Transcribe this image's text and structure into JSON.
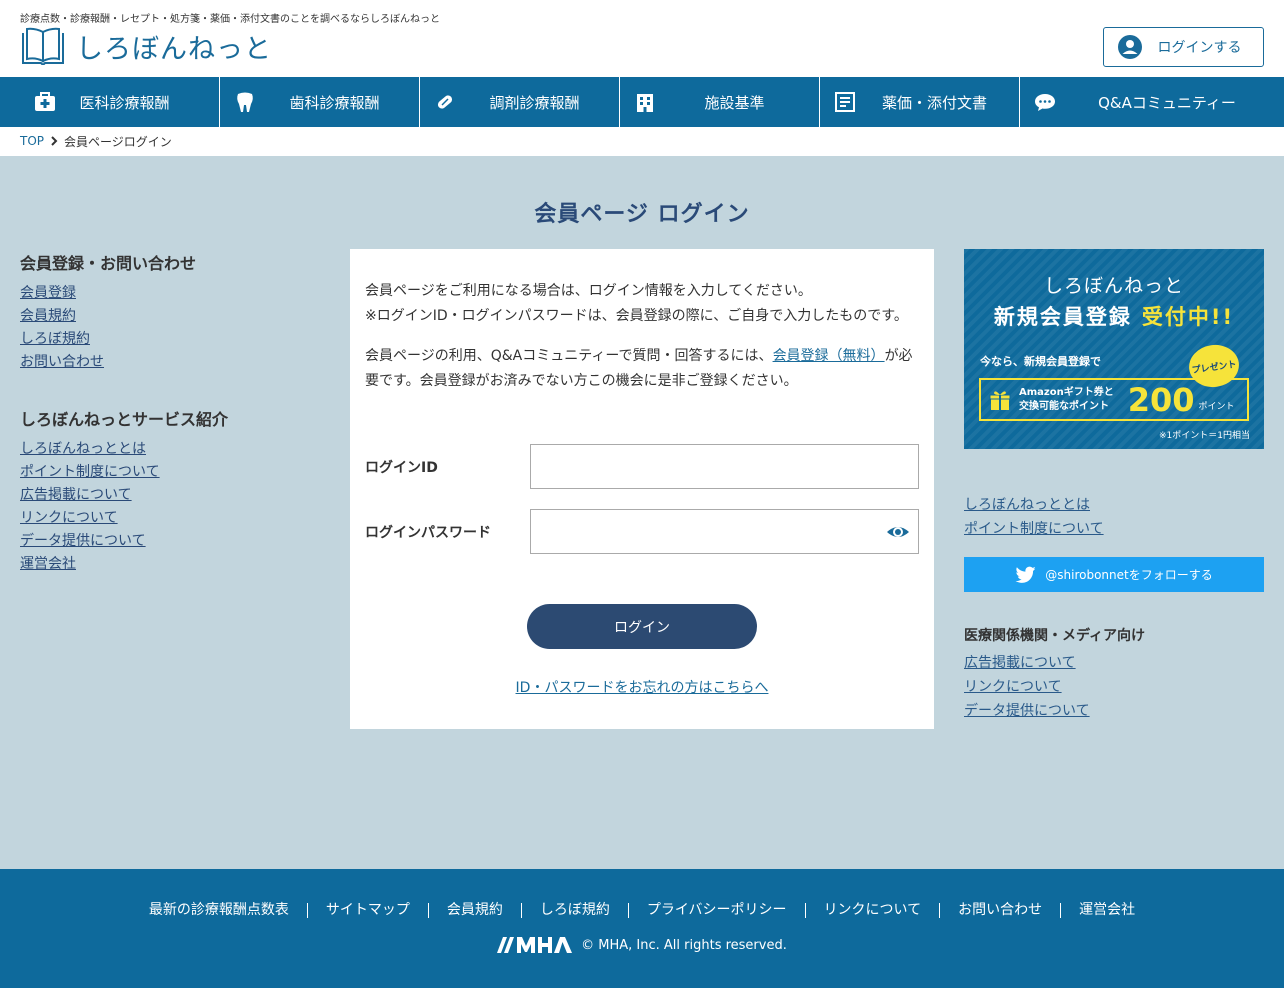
{
  "header": {
    "tagline": "診療点数・診療報酬・レセプト・処方箋・薬価・添付文書のことを調べるならしろぼんねっと",
    "logo_text": "しろぼんねっと",
    "login_button": "ログインする"
  },
  "nav": {
    "items": [
      {
        "label": "医科診療報酬",
        "icon": "medical-kit-icon"
      },
      {
        "label": "歯科診療報酬",
        "icon": "tooth-icon"
      },
      {
        "label": "調剤診療報酬",
        "icon": "pill-icon"
      },
      {
        "label": "施設基準",
        "icon": "hospital-building-icon"
      },
      {
        "label": "薬価・添付文書",
        "icon": "document-icon"
      },
      {
        "label": "Q&Aコミュニティー",
        "icon": "chat-bubble-icon"
      }
    ]
  },
  "breadcrumb": {
    "top": "TOP",
    "current": "会員ページログイン"
  },
  "page_title": "会員ページ ログイン",
  "left_sidebar": {
    "section1": {
      "heading": "会員登録・お問い合わせ",
      "links": [
        "会員登録",
        "会員規約",
        "しろぼ規約",
        "お問い合わせ"
      ]
    },
    "section2": {
      "heading": "しろぼんねっとサービス紹介",
      "links": [
        "しろぼんねっととは",
        "ポイント制度について",
        "広告掲載について",
        "リンクについて",
        "データ提供について",
        "運営会社"
      ]
    }
  },
  "login_card": {
    "intro_line1": "会員ページをご利用になる場合は、ログイン情報を入力してください。",
    "intro_line2": "※ログインID・ログインパスワードは、会員登録の際に、ご自身で入力したものです。",
    "register_text_before": "会員ページの利用、Q&Aコミュニティーで質問・回答するには、",
    "register_link": "会員登録（無料）",
    "register_text_after": "が必要です。会員登録がお済みでない方この機会に是非ご登録ください。",
    "id_label": "ログインID",
    "id_value": "",
    "password_label": "ログインパスワード",
    "password_value": "",
    "submit_label": "ログイン",
    "forgot_link": "ID・パスワードをお忘れの方はこちらへ"
  },
  "banner": {
    "line1": "しろぼんねっと",
    "line2_main": "新規会員登録",
    "line2_accent": "受付中!!",
    "line3": "今なら、新規会員登録で",
    "bubble": "プレゼント",
    "gift_text_1": "Amazonギフト券と",
    "gift_text_2": "交換可能なポイント",
    "points": "200",
    "points_unit": "ポイント",
    "note": "※1ポイント＝1円相当",
    "accent_color": "#f6e33a"
  },
  "right_sidebar": {
    "links1": [
      "しろぼんねっととは",
      "ポイント制度について"
    ],
    "twitter_label": "@shirobonnetをフォローする",
    "heading": "医療関係機関・メディア向け",
    "links2": [
      "広告掲載について",
      "リンクについて",
      "データ提供について"
    ]
  },
  "footer": {
    "links": [
      "最新の診療報酬点数表",
      "サイトマップ",
      "会員規約",
      "しろぼ規約",
      "プライバシーポリシー",
      "リンクについて",
      "お問い合わせ",
      "運営会社"
    ],
    "copyright": "© MHA, Inc. All rights reserved.",
    "brand_color": "#0e6a9c"
  }
}
